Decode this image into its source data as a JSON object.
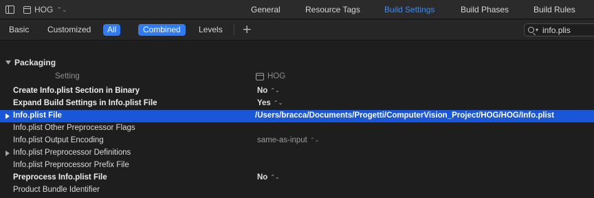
{
  "topbar": {
    "target_name": "HOG",
    "tabs": [
      "General",
      "Resource Tags",
      "Build Settings",
      "Build Phases",
      "Build Rules"
    ],
    "active_tab": "Build Settings"
  },
  "filterbar": {
    "scope_basic": "Basic",
    "scope_customized": "Customized",
    "scope_all": "All",
    "view_combined": "Combined",
    "view_levels": "Levels",
    "search_value": "info.plis",
    "accent_color": "#2f7bf5"
  },
  "table": {
    "section_title": "Packaging",
    "col_setting": "Setting",
    "col_target": "HOG",
    "rows": [
      {
        "name": "Create Info.plist Section in Binary",
        "value": "No"
      },
      {
        "name": "Expand Build Settings in Info.plist File",
        "value": "Yes"
      },
      {
        "name": "Info.plist File",
        "value": "/Users/bracca/Documents/Progetti/ComputerVision_Project/HOG/HOG/Info.plist"
      },
      {
        "name": "Info.plist Other Preprocessor Flags",
        "value": ""
      },
      {
        "name": "Info.plist Output Encoding",
        "value": "same-as-input"
      },
      {
        "name": "Info.plist Preprocessor Definitions",
        "value": ""
      },
      {
        "name": "Info.plist Preprocessor Prefix File",
        "value": ""
      },
      {
        "name": "Preprocess Info.plist File",
        "value": "No"
      },
      {
        "name": "Product Bundle Identifier",
        "value": ""
      }
    ],
    "selected_color": "#1a56d8"
  }
}
